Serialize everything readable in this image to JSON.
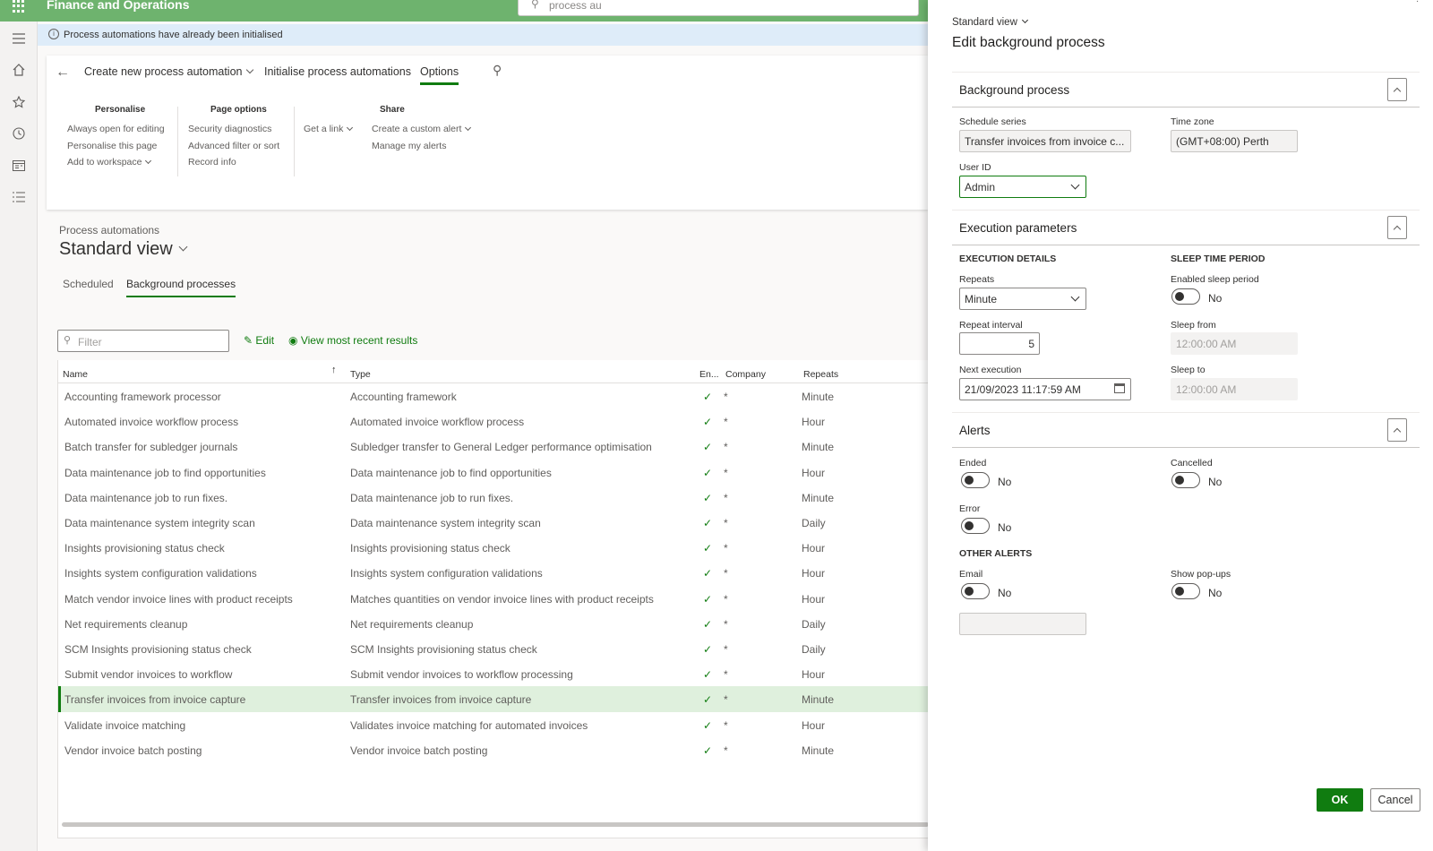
{
  "app": {
    "title": "Finance and Operations",
    "search_value": "process au"
  },
  "info_bar": {
    "message": "Process automations have already been initialised"
  },
  "action_pane": {
    "tabs": [
      "Create new process automation",
      "Initialise process automations",
      "Options"
    ],
    "groups": {
      "personalise": {
        "title": "Personalise",
        "items": [
          "Always open for editing",
          "Personalise this page",
          "Add to workspace"
        ]
      },
      "page_options": {
        "title": "Page options",
        "items": [
          "Security diagnostics",
          "Advanced filter or sort",
          "Record info"
        ]
      },
      "share": {
        "title": "Share",
        "get_link": "Get a link",
        "items": [
          "Create a custom alert",
          "Manage my alerts"
        ]
      }
    }
  },
  "page": {
    "breadcrumb": "Process automations",
    "view_name": "Standard view",
    "pivots": [
      "Scheduled",
      "Background processes"
    ]
  },
  "toolbar": {
    "filter_placeholder": "Filter",
    "edit_label": "Edit",
    "view_results_label": "View most recent results"
  },
  "grid": {
    "columns": [
      "Name",
      "Type",
      "En...",
      "Company",
      "Repeats"
    ],
    "rows": [
      {
        "name": "Accounting framework processor",
        "type": "Accounting framework",
        "enabled": "✓",
        "company": "*",
        "repeats": "Minute"
      },
      {
        "name": "Automated invoice workflow process",
        "type": "Automated invoice workflow process",
        "enabled": "✓",
        "company": "*",
        "repeats": "Hour"
      },
      {
        "name": "Batch transfer for subledger journals",
        "type": "Subledger transfer to General Ledger performance optimisation",
        "enabled": "✓",
        "company": "*",
        "repeats": "Minute"
      },
      {
        "name": "Data maintenance job to find opportunities",
        "type": "Data maintenance job to find opportunities",
        "enabled": "✓",
        "company": "*",
        "repeats": "Hour"
      },
      {
        "name": "Data maintenance job to run fixes.",
        "type": "Data maintenance job to run fixes.",
        "enabled": "✓",
        "company": "*",
        "repeats": "Minute"
      },
      {
        "name": "Data maintenance system integrity scan",
        "type": "Data maintenance system integrity scan",
        "enabled": "✓",
        "company": "*",
        "repeats": "Daily"
      },
      {
        "name": "Insights provisioning status check",
        "type": "Insights provisioning status check",
        "enabled": "✓",
        "company": "*",
        "repeats": "Hour"
      },
      {
        "name": "Insights system configuration validations",
        "type": "Insights system configuration validations",
        "enabled": "✓",
        "company": "*",
        "repeats": "Hour"
      },
      {
        "name": "Match vendor invoice lines with product receipts",
        "type": "Matches quantities on vendor invoice lines with product receipts",
        "enabled": "✓",
        "company": "*",
        "repeats": "Hour"
      },
      {
        "name": "Net requirements cleanup",
        "type": "Net requirements cleanup",
        "enabled": "✓",
        "company": "*",
        "repeats": "Daily"
      },
      {
        "name": "SCM Insights provisioning status check",
        "type": "SCM Insights provisioning status check",
        "enabled": "✓",
        "company": "*",
        "repeats": "Daily"
      },
      {
        "name": "Submit vendor invoices to workflow",
        "type": "Submit vendor invoices to workflow processing",
        "enabled": "✓",
        "company": "*",
        "repeats": "Hour"
      },
      {
        "name": "Transfer invoices from invoice capture",
        "type": "Transfer invoices from invoice capture",
        "enabled": "✓",
        "company": "*",
        "repeats": "Minute"
      },
      {
        "name": "Validate invoice matching",
        "type": "Validates invoice matching for automated invoices",
        "enabled": "✓",
        "company": "*",
        "repeats": "Hour"
      },
      {
        "name": "Vendor invoice batch posting",
        "type": "Vendor invoice batch posting",
        "enabled": "✓",
        "company": "*",
        "repeats": "Minute"
      }
    ],
    "selected_row": 12
  },
  "panel": {
    "view_name": "Standard view",
    "title": "Edit background process",
    "background_process": {
      "header": "Background process",
      "schedule_series_label": "Schedule series",
      "schedule_series_value": "Transfer invoices from invoice c...",
      "time_zone_label": "Time zone",
      "time_zone_value": "(GMT+08:00) Perth",
      "user_id_label": "User ID",
      "user_id_value": "Admin"
    },
    "execution": {
      "header": "Execution parameters",
      "details_title": "EXECUTION DETAILS",
      "sleep_title": "SLEEP TIME PERIOD",
      "repeats_label": "Repeats",
      "repeats_value": "Minute",
      "repeat_interval_label": "Repeat interval",
      "repeat_interval_value": "5",
      "next_execution_label": "Next execution",
      "next_execution_value": "21/09/2023 11:17:59 AM",
      "enabled_sleep_label": "Enabled sleep period",
      "enabled_sleep_value": "No",
      "sleep_from_label": "Sleep from",
      "sleep_from_value": "12:00:00 AM",
      "sleep_to_label": "Sleep to",
      "sleep_to_value": "12:00:00 AM"
    },
    "alerts": {
      "header": "Alerts",
      "ended_label": "Ended",
      "ended_value": "No",
      "cancelled_label": "Cancelled",
      "cancelled_value": "No",
      "error_label": "Error",
      "error_value": "No",
      "other_title": "OTHER ALERTS",
      "email_label": "Email",
      "email_value": "No",
      "popups_label": "Show pop-ups",
      "popups_value": "No",
      "email_address_value": ""
    },
    "ok_label": "OK",
    "cancel_label": "Cancel"
  }
}
